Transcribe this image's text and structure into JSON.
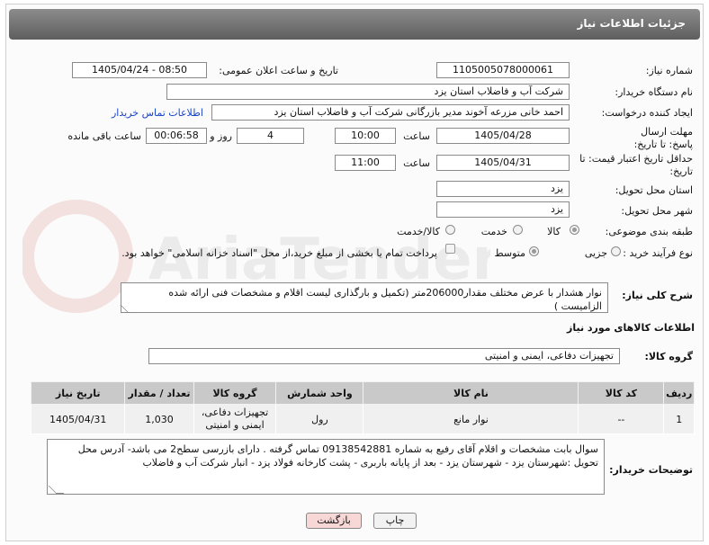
{
  "header": {
    "title": "جزئیات اطلاعات نیاز"
  },
  "labels": {
    "need_number": "شماره نیاز:",
    "announce_datetime": "تاریخ و ساعت اعلان عمومی:",
    "buyer_org": "نام دستگاه خریدار:",
    "requester": "ایجاد کننده درخواست:",
    "reply_deadline": "مهلت ارسال پاسخ: تا تاریخ:",
    "price_deadline": "حداقل تاریخ اعتبار قیمت: تا تاریخ:",
    "time": "ساعت",
    "day_and": "روز و",
    "remaining": "ساعت باقی مانده",
    "province": "استان محل تحویل:",
    "city": "شهر محل تحویل:",
    "category": "طبقه بندی موضوعی:",
    "process_type": "نوع فرآیند خرید :",
    "general_desc": "شرح کلی نیاز:",
    "goods_info": "اطلاعات کالاهای مورد نیاز",
    "goods_group": "گروه کالا:",
    "buyer_notes": "توضیحات خریدار:"
  },
  "fields": {
    "need_number": "1105005078000061",
    "announce_datetime": "1405/04/24 - 08:50",
    "buyer_org": "شرکت آب و فاضلاب استان یزد",
    "requester": "احمد خانی مزرعه آخوند مدیر بازرگانی شرکت آب و فاضلاب استان یزد",
    "contact_link": "اطلاعات تماس خریدار",
    "reply_date": "1405/04/28",
    "reply_time": "10:00",
    "reply_days": "4",
    "reply_remaining": "00:06:58",
    "price_date": "1405/04/31",
    "price_time": "11:00",
    "province": "یزد",
    "city": "یزد",
    "general_desc": "نوار هشدار با عرض مختلف مقدار206000متر (تکمیل و بارگذاری لیست اقلام و مشخصات فنی ارائه شده الزامیست )",
    "goods_group": "تجهیزات دفاعی، ایمنی و امنیتی",
    "buyer_notes": "سوال بابت مشخصات و اقلام آقای رفیع به شماره 09138542881 تماس گرفته . دارای بازرسی سطح2 می باشد- آدرس محل تحویل :شهرستان یزد - شهرستان یزد - بعد از پایانه باربری - پشت کارخانه فولاد یزد - انبار شرکت آب و فاضلاب"
  },
  "category_options": {
    "goods": "کالا",
    "service": "خدمت",
    "goods_service": "کالا/خدمت",
    "selected": "کالا"
  },
  "process_options": {
    "partial": "جزیی",
    "medium": "متوسط",
    "selected": "متوسط",
    "payment_note": "پرداخت تمام یا بخشی از مبلغ خرید،از محل \"اسناد خزانه اسلامی\" خواهد بود."
  },
  "table": {
    "headers": [
      "ردیف",
      "کد کالا",
      "نام کالا",
      "واحد شمارش",
      "گروه کالا",
      "تعداد / مقدار",
      "تاریخ نیاز"
    ],
    "rows": [
      [
        "1",
        "--",
        "نوار مانع",
        "رول",
        "تجهیزات دفاعی، ایمنی و امنیتی",
        "1,030",
        "1405/04/31"
      ]
    ]
  },
  "buttons": {
    "print": "چاپ",
    "back": "بازگشت"
  },
  "watermark": {
    "text": "AriaTender.net"
  },
  "colors": {
    "header": "#6e6e6e",
    "link": "#1a44c9",
    "back_button": "#f8d7d7",
    "print_button": "#f2f2f2"
  }
}
